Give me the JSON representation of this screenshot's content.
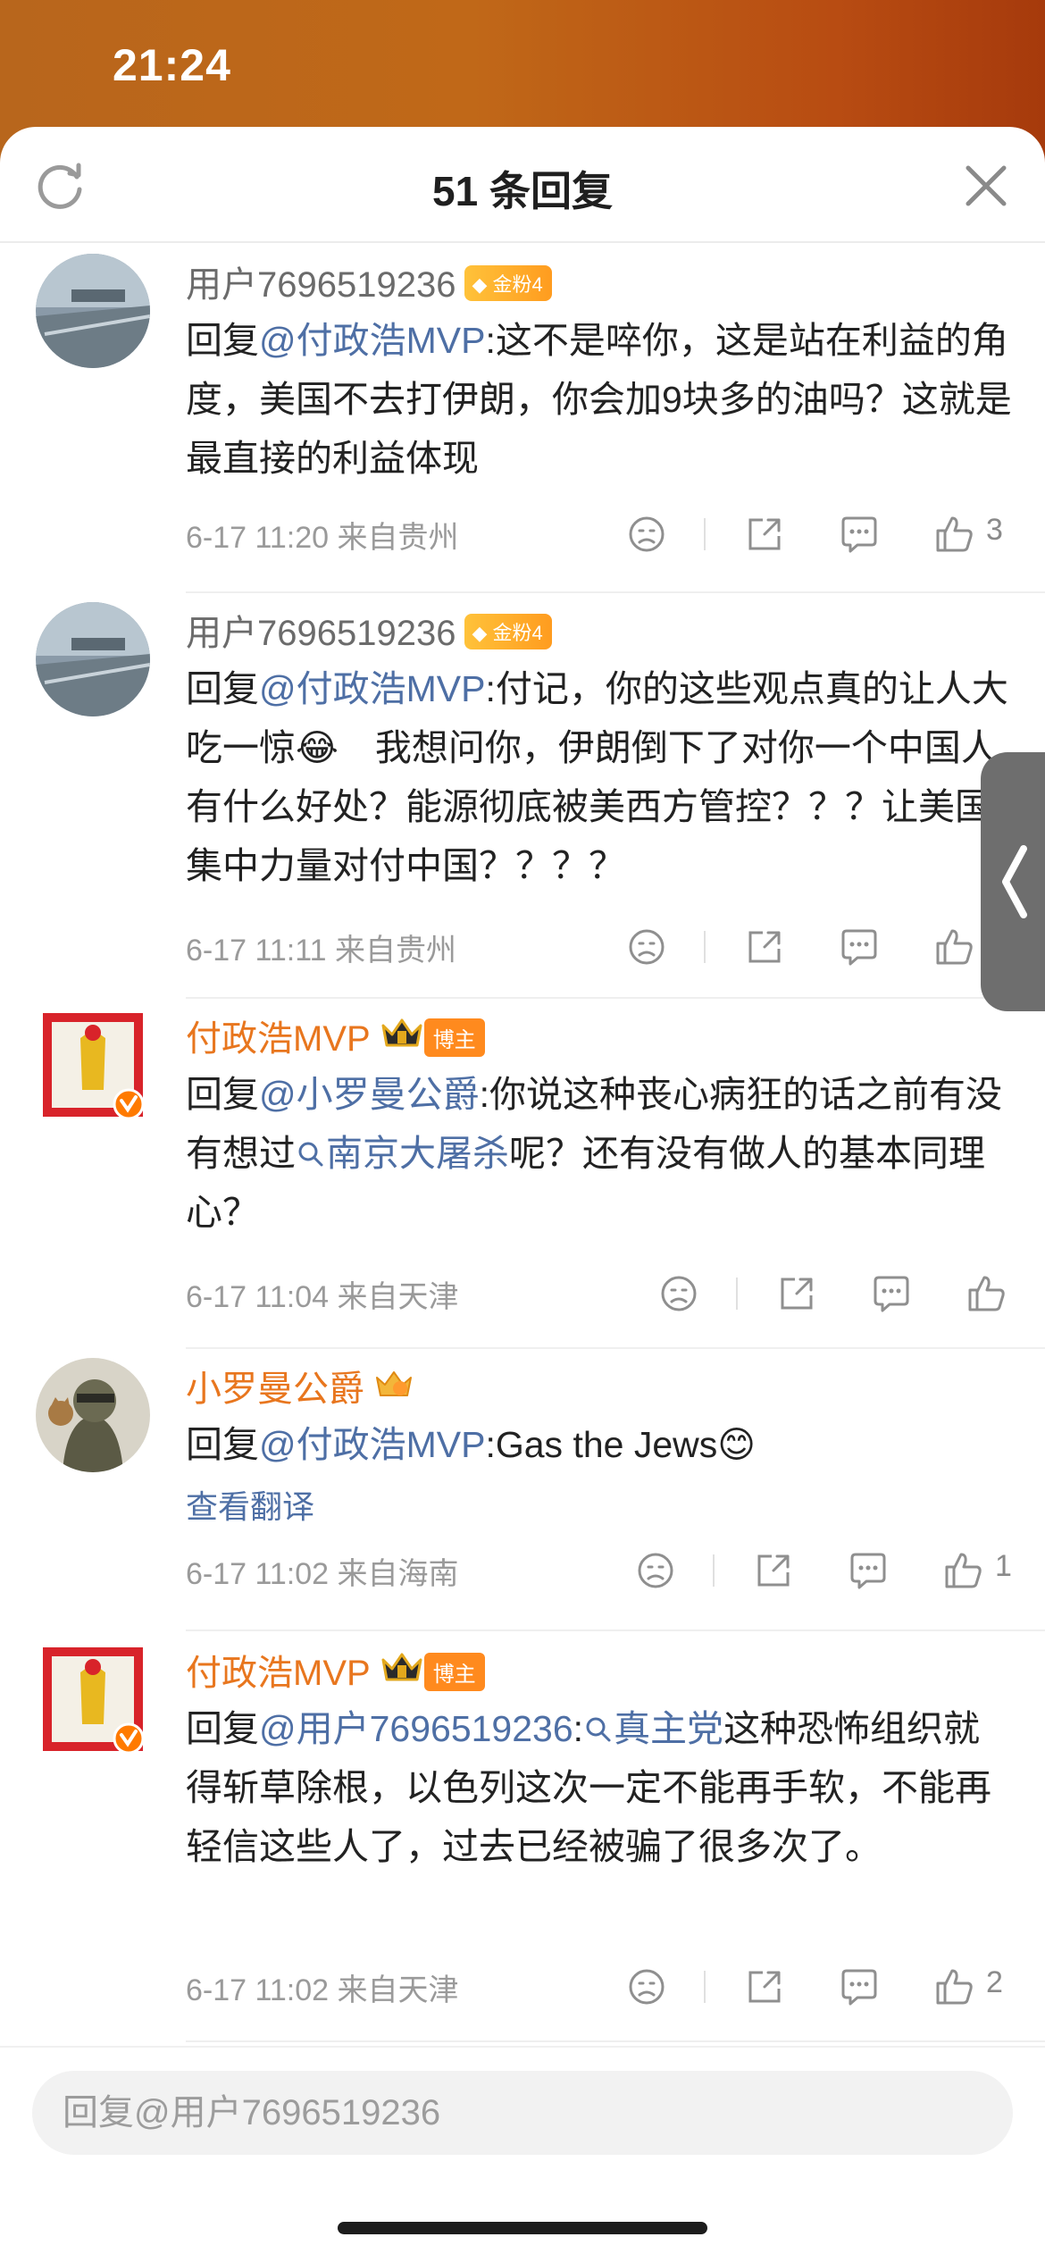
{
  "status_bar": {
    "time": "21:24"
  },
  "header": {
    "title": "51 条回复",
    "refresh_icon": "refresh-icon",
    "close_icon": "close-icon"
  },
  "comments": [
    {
      "username": "用户7696519236",
      "badge": "金粉4",
      "reply_prefix": "回复",
      "mention": "@付政浩MVP",
      "text": ":这不是啐你，这是站在利益的角度，美国不去打伊朗，你会加9块多的油吗？这就是最直接的利益体现",
      "timestamp": "6-17 11:20",
      "location": "来自贵州",
      "likes": "3"
    },
    {
      "username": "用户7696519236",
      "badge": "金粉4",
      "reply_prefix": "回复",
      "mention": "@付政浩MVP",
      "text": ":付记，你的这些观点真的让人大吃一惊",
      "emoji": "😂",
      "text2": "　我想问你，伊朗倒下了对你一个中国人有什么好处？能源彻底被美西方管控？？？让美国集中力量对付中国？？？？",
      "timestamp": "6-17 11:11",
      "location": "来自贵州",
      "likes": ""
    },
    {
      "username": "付政浩MVP",
      "badge": "博主",
      "reply_prefix": "回复",
      "mention": "@小罗曼公爵",
      "text": ":你说这种丧心病狂的话之前有没有想过",
      "topic": "南京大屠杀",
      "text2": "呢？还有没有做人的基本同理心？",
      "timestamp": "6-17 11:04",
      "location": "来自天津",
      "likes": ""
    },
    {
      "username": "小罗曼公爵",
      "reply_prefix": "回复",
      "mention": "@付政浩MVP",
      "text": ":Gas the Jews",
      "emoji": "😊",
      "translate": "查看翻译",
      "timestamp": "6-17 11:02",
      "location": "来自海南",
      "likes": "1"
    },
    {
      "username": "付政浩MVP",
      "badge": "博主",
      "reply_prefix": "回复",
      "mention": "@用户7696519236",
      "text": ":",
      "topic": "真主党",
      "text2": "这种恐怖组织就得斩草除根，以色列这次一定不能再手软，不能再轻信这些人了，过去已经被骗了很多次了。",
      "timestamp": "6-17 11:02",
      "location": "来自天津",
      "likes": "2"
    }
  ],
  "reply_bar": {
    "placeholder": "回复@用户7696519236"
  },
  "colors": {
    "accent_orange": "#e8761e",
    "link_blue": "#4e6fa5",
    "meta_gray": "#9a9a9a"
  }
}
